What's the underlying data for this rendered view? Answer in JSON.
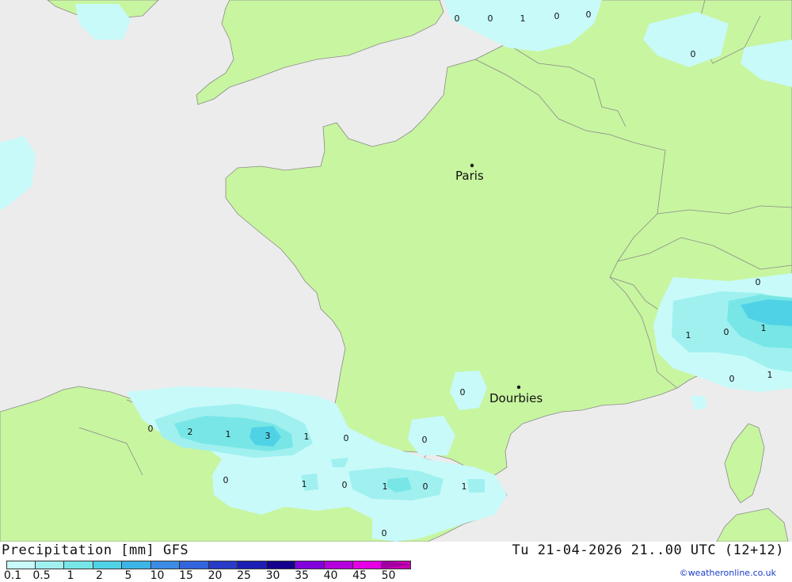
{
  "map": {
    "cities": [
      {
        "name": "Paris"
      },
      {
        "name": "Dourbies"
      }
    ],
    "precip_labels": [
      "0",
      "0",
      "1",
      "0",
      "0",
      "0",
      "2",
      "1",
      "3",
      "1",
      "0",
      "0",
      "0",
      "1",
      "0",
      "1",
      "0",
      "1",
      "0",
      "0",
      "1",
      "0",
      "0",
      "1"
    ]
  },
  "footer": {
    "title": "Precipitation [mm] GFS",
    "valid_time": "Tu 21-04-2026 21..00 UTC (12+12)",
    "credit": "©weatheronline.co.uk",
    "scale": [
      {
        "label": "0.1",
        "color": "#c8fafa"
      },
      {
        "label": "0.5",
        "color": "#a0f0f0"
      },
      {
        "label": "1",
        "color": "#78e6e6"
      },
      {
        "label": "2",
        "color": "#50d2e6"
      },
      {
        "label": "5",
        "color": "#3cb4e6"
      },
      {
        "label": "10",
        "color": "#3c8ce6"
      },
      {
        "label": "15",
        "color": "#3264dc"
      },
      {
        "label": "20",
        "color": "#283cc8"
      },
      {
        "label": "25",
        "color": "#1e1eb4"
      },
      {
        "label": "30",
        "color": "#14008c"
      },
      {
        "label": "35",
        "color": "#8200dc"
      },
      {
        "label": "40",
        "color": "#b400dc"
      },
      {
        "label": "45",
        "color": "#e600e6"
      },
      {
        "label": "50",
        "color": "#c800b4"
      }
    ]
  },
  "colors": {
    "sea": "#ececec",
    "land": "#c8f5a0",
    "border": "#8a8a8a"
  }
}
